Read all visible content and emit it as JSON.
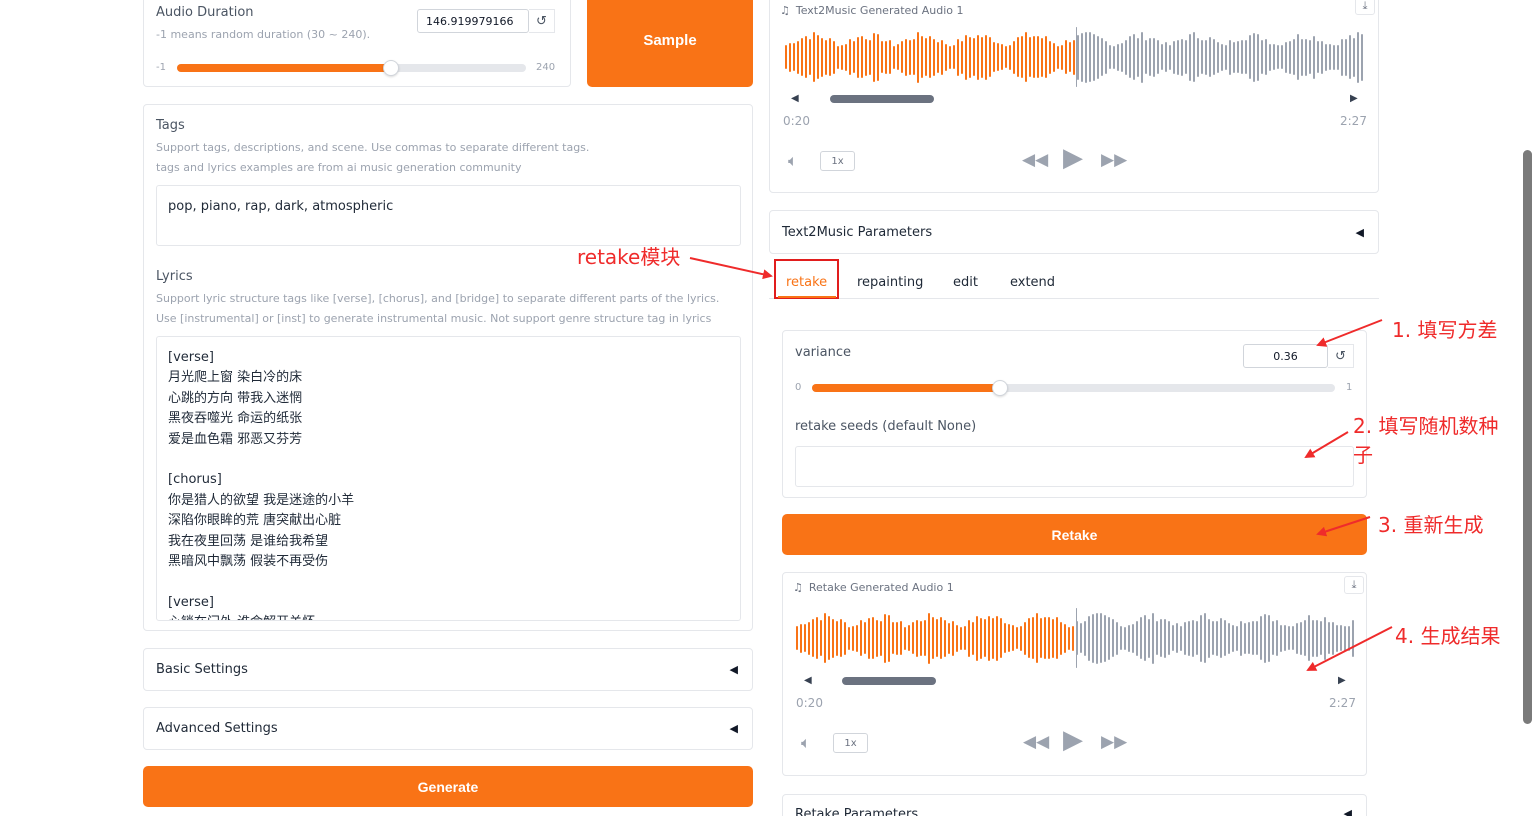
{
  "audio_duration": {
    "label": "Audio Duration",
    "info": "-1 means random duration (30 ~ 240).",
    "value": "146.919979166",
    "min_label": "-1",
    "max_label": "240",
    "min": -1,
    "max": 240,
    "current": 146.92,
    "reset_icon": "↺"
  },
  "sample_button": "Sample",
  "tags": {
    "label": "Tags",
    "info1": "Support tags, descriptions, and scene. Use commas to separate different tags.",
    "info2": "tags and lyrics examples are from ai music generation community",
    "value": "pop, piano, rap, dark, atmospheric"
  },
  "lyrics": {
    "label": "Lyrics",
    "info1": "Support lyric structure tags like [verse], [chorus], and [bridge] to separate different parts of the lyrics.",
    "info2": "Use [instrumental] or [inst] to generate instrumental music. Not support genre structure tag in lyrics",
    "value": "[verse]\n月光爬上窗 染白冷的床\n心跳的方向 带我入迷惘\n黑夜吞噬光 命运的纸张\n爱是血色霜 邪恶又芬芳\n\n[chorus]\n你是猎人的欲望 我是迷途的小羊\n深陷你眼眸的荒 唐突献出心脏\n我在夜里回荡 是谁给我希望\n黑暗风中飘荡 假装不再受伤\n\n[verse]\n心锁在门外 谁命解开关怀"
  },
  "basic_settings": "Basic Settings",
  "advanced_settings": "Advanced Settings",
  "generate_button": "Generate",
  "audio1": {
    "title": "Text2Music Generated Audio 1",
    "time_current": "0:20",
    "time_total": "2:27",
    "rate": "1x",
    "progress": 0.136
  },
  "params_accordion": "Text2Music Parameters",
  "tabs": [
    "retake",
    "repainting",
    "edit",
    "extend"
  ],
  "variance": {
    "label": "variance",
    "value": "0.36",
    "min_label": "0",
    "max_label": "1",
    "current": 0.36,
    "reset_icon": "↺"
  },
  "retake_seeds": {
    "label": "retake seeds (default None)",
    "value": ""
  },
  "retake_button": "Retake",
  "audio2": {
    "title": "Retake Generated Audio 1",
    "time_current": "0:20",
    "time_total": "2:27",
    "rate": "1x",
    "progress": 0.136
  },
  "retake_params": "Retake Parameters",
  "annotations": {
    "module": "retake模块",
    "step1": "1. 填写方差",
    "step2a": "2. 填写随机数种",
    "step2b": "子",
    "step3": "3. 重新生成",
    "step4": "4. 生成结果"
  },
  "colors": {
    "accent": "#f97316",
    "annotation": "#ef2b2b",
    "wave_played": "#f97316",
    "wave_unplayed": "#9ca3af"
  },
  "icons": [
    "reset-icon",
    "music-note-icon",
    "download-icon",
    "volume-icon",
    "rewind-icon",
    "play-icon",
    "fast-forward-icon",
    "triangle-left-icon"
  ]
}
